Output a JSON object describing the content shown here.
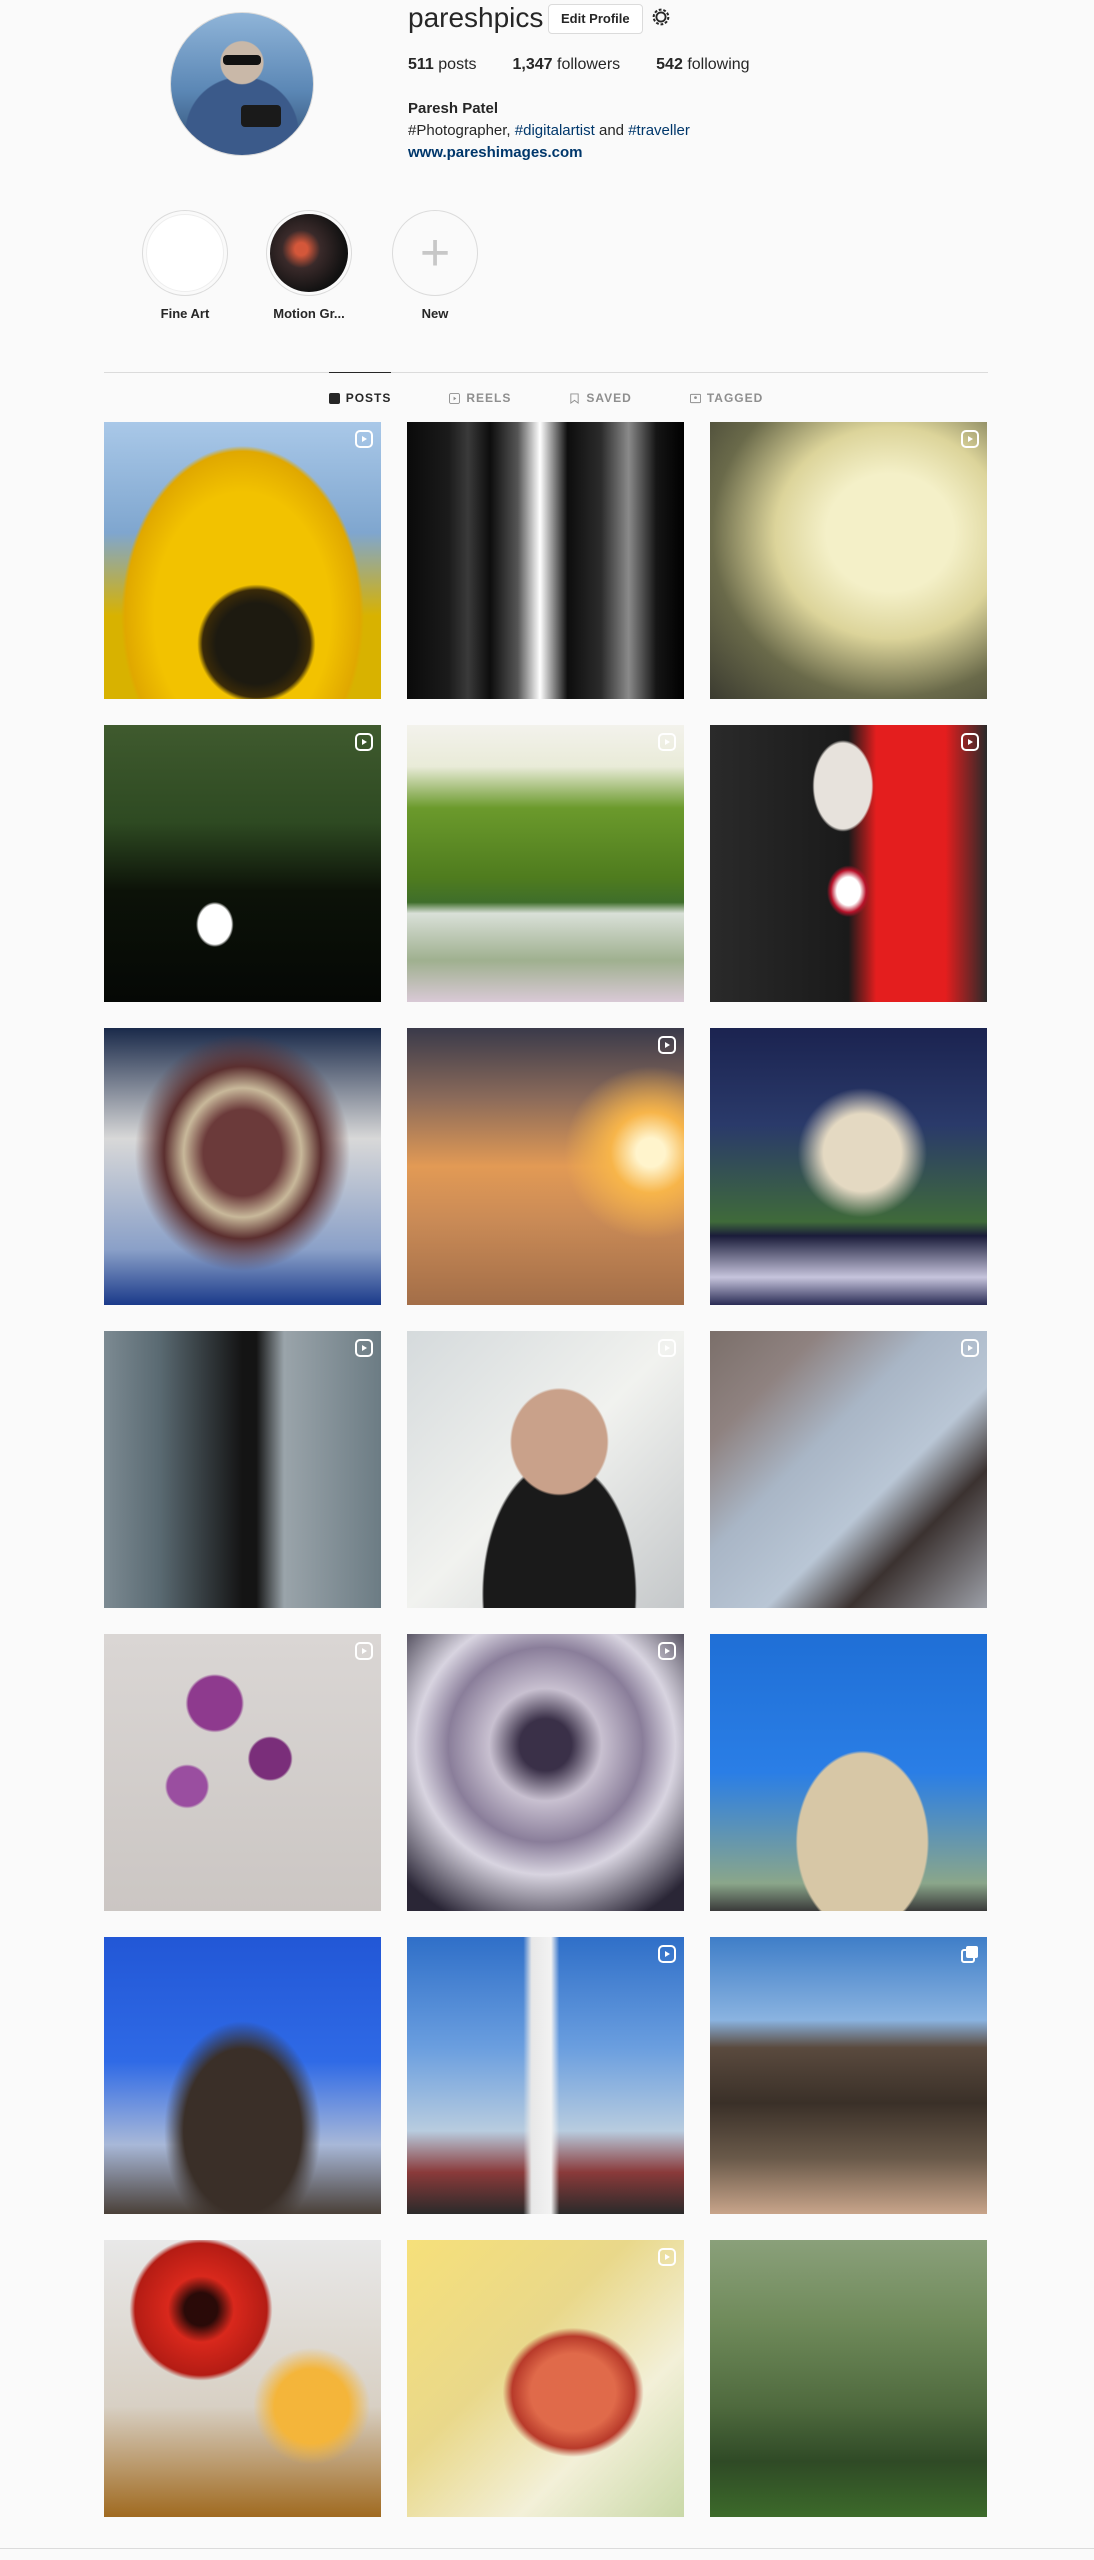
{
  "profile": {
    "username": "pareshpics",
    "edit_label": "Edit Profile",
    "posts_count": "511",
    "posts_label": "posts",
    "followers_count": "1,347",
    "followers_label": "followers",
    "following_count": "542",
    "following_label": "following",
    "full_name": "Paresh Patel",
    "bio_prefix": "#Photographer, ",
    "bio_tag1": "#digitalartist",
    "bio_mid": " and ",
    "bio_tag2": "#traveller",
    "website": "www.pareshimages.com"
  },
  "highlights": [
    {
      "label": "Fine Art"
    },
    {
      "label": "Motion Gr..."
    },
    {
      "label": "New",
      "icon": "plus-icon"
    }
  ],
  "tabs": [
    {
      "label": "POSTS",
      "icon": "grid-icon",
      "active": true
    },
    {
      "label": "REELS",
      "icon": "reels-icon"
    },
    {
      "label": "SAVED",
      "icon": "bookmark-icon"
    },
    {
      "label": "TAGGED",
      "icon": "tag-icon"
    }
  ],
  "posts": [
    {
      "subject": "sunflower",
      "badge": "reel-icon"
    },
    {
      "subject": "skyscrapers",
      "badge": ""
    },
    {
      "subject": "white chrysanthemum",
      "badge": "reel-icon"
    },
    {
      "subject": "swan",
      "badge": "reel-icon"
    },
    {
      "subject": "trees by pond",
      "badge": "reel-icon"
    },
    {
      "subject": "vampire makeup",
      "badge": "reel-icon"
    },
    {
      "subject": "iron man statue",
      "badge": ""
    },
    {
      "subject": "desert sunset",
      "badge": "reel-icon"
    },
    {
      "subject": "pagoda tower",
      "badge": ""
    },
    {
      "subject": "glass doors",
      "badge": "reel-icon"
    },
    {
      "subject": "selfie sunglasses",
      "badge": "reel-icon"
    },
    {
      "subject": "architecture",
      "badge": "reel-icon"
    },
    {
      "subject": "orchids",
      "badge": "reel-icon"
    },
    {
      "subject": "dandelion",
      "badge": "reel-icon"
    },
    {
      "subject": "paris las vegas",
      "badge": ""
    },
    {
      "subject": "eiffel tower",
      "badge": ""
    },
    {
      "subject": "stratosphere tower",
      "badge": "reel-icon"
    },
    {
      "subject": "grand canyon",
      "badge": "carousel-icon"
    },
    {
      "subject": "gerbera daisies",
      "badge": ""
    },
    {
      "subject": "tulip",
      "badge": "reel-icon"
    },
    {
      "subject": "forest",
      "badge": ""
    }
  ],
  "colors": {
    "link": "#00376b",
    "border": "#dbdbdb",
    "muted": "#8e8e8e"
  }
}
